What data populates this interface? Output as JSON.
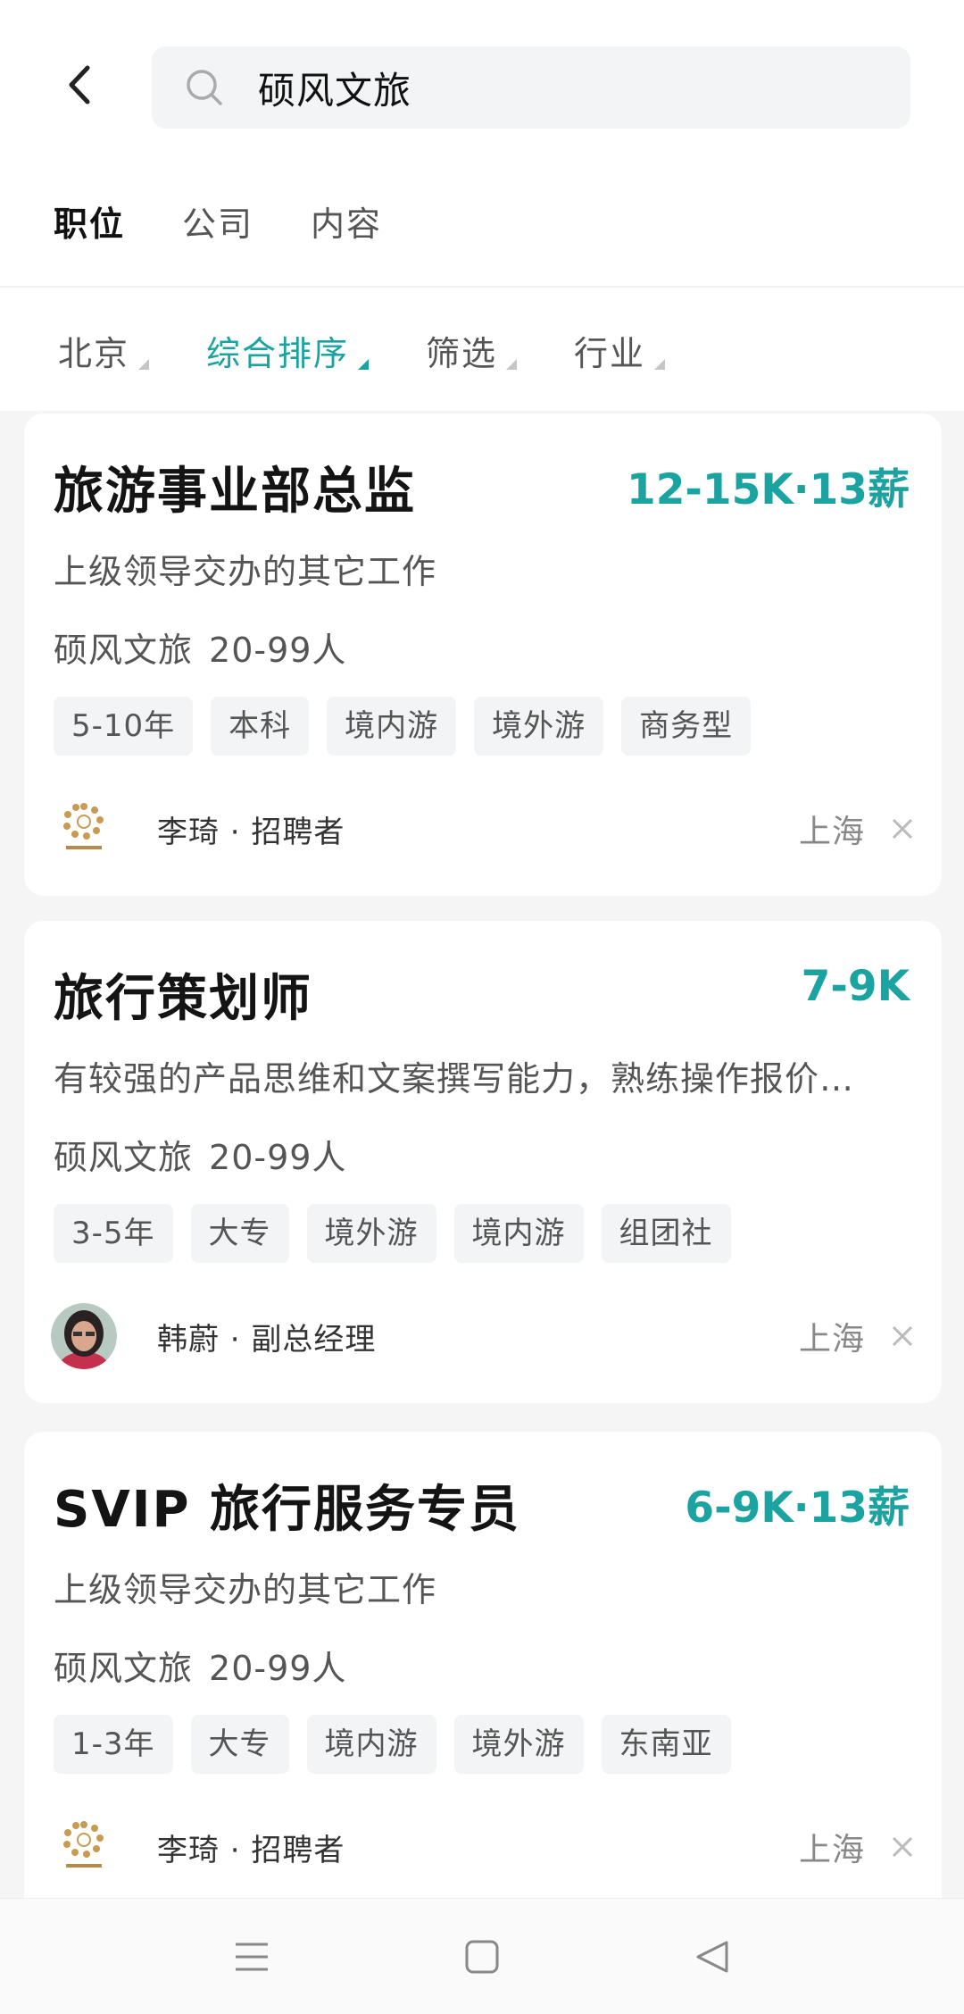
{
  "search": {
    "query": "硕风文旅"
  },
  "tabs": [
    {
      "label": "职位",
      "active": true
    },
    {
      "label": "公司",
      "active": false
    },
    {
      "label": "内容",
      "active": false
    }
  ],
  "filters": [
    {
      "label": "北京",
      "active": false
    },
    {
      "label": "综合排序",
      "active": true
    },
    {
      "label": "筛选",
      "active": false
    },
    {
      "label": "行业",
      "active": false
    }
  ],
  "jobs": [
    {
      "title": "旅游事业部总监",
      "salary": "12-15K·13薪",
      "description": "上级领导交办的其它工作",
      "company": "硕风文旅",
      "company_size": "20-99人",
      "tags": [
        "5-10年",
        "本科",
        "境内游",
        "境外游",
        "商务型"
      ],
      "recruiter": "李琦 · 招聘者",
      "avatar": "company-logo",
      "city": "上海"
    },
    {
      "title": "旅行策划师",
      "salary": "7-9K",
      "description": "有较强的产品思维和文案撰写能力，熟练操作报价…",
      "company": "硕风文旅",
      "company_size": "20-99人",
      "tags": [
        "3-5年",
        "大专",
        "境外游",
        "境内游",
        "组团社"
      ],
      "recruiter": "韩蔚 · 副总经理",
      "avatar": "person-photo",
      "city": "上海"
    },
    {
      "title": "SVIP 旅行服务专员",
      "salary": "6-9K·13薪",
      "description": "上级领导交办的其它工作",
      "company": "硕风文旅",
      "company_size": "20-99人",
      "tags": [
        "1-3年",
        "大专",
        "境内游",
        "境外游",
        "东南亚"
      ],
      "recruiter": "李琦 · 招聘者",
      "avatar": "company-logo",
      "city": "上海"
    }
  ],
  "colors": {
    "accent": "#1aa3a0",
    "tag_bg": "#f3f4f5",
    "page_bg": "#f5f5f5"
  },
  "icons": {
    "back": "back-arrow-icon",
    "search": "search-icon",
    "dismiss": "close-icon",
    "nav": [
      "menu-icon",
      "home-square-icon",
      "back-triangle-icon"
    ]
  }
}
